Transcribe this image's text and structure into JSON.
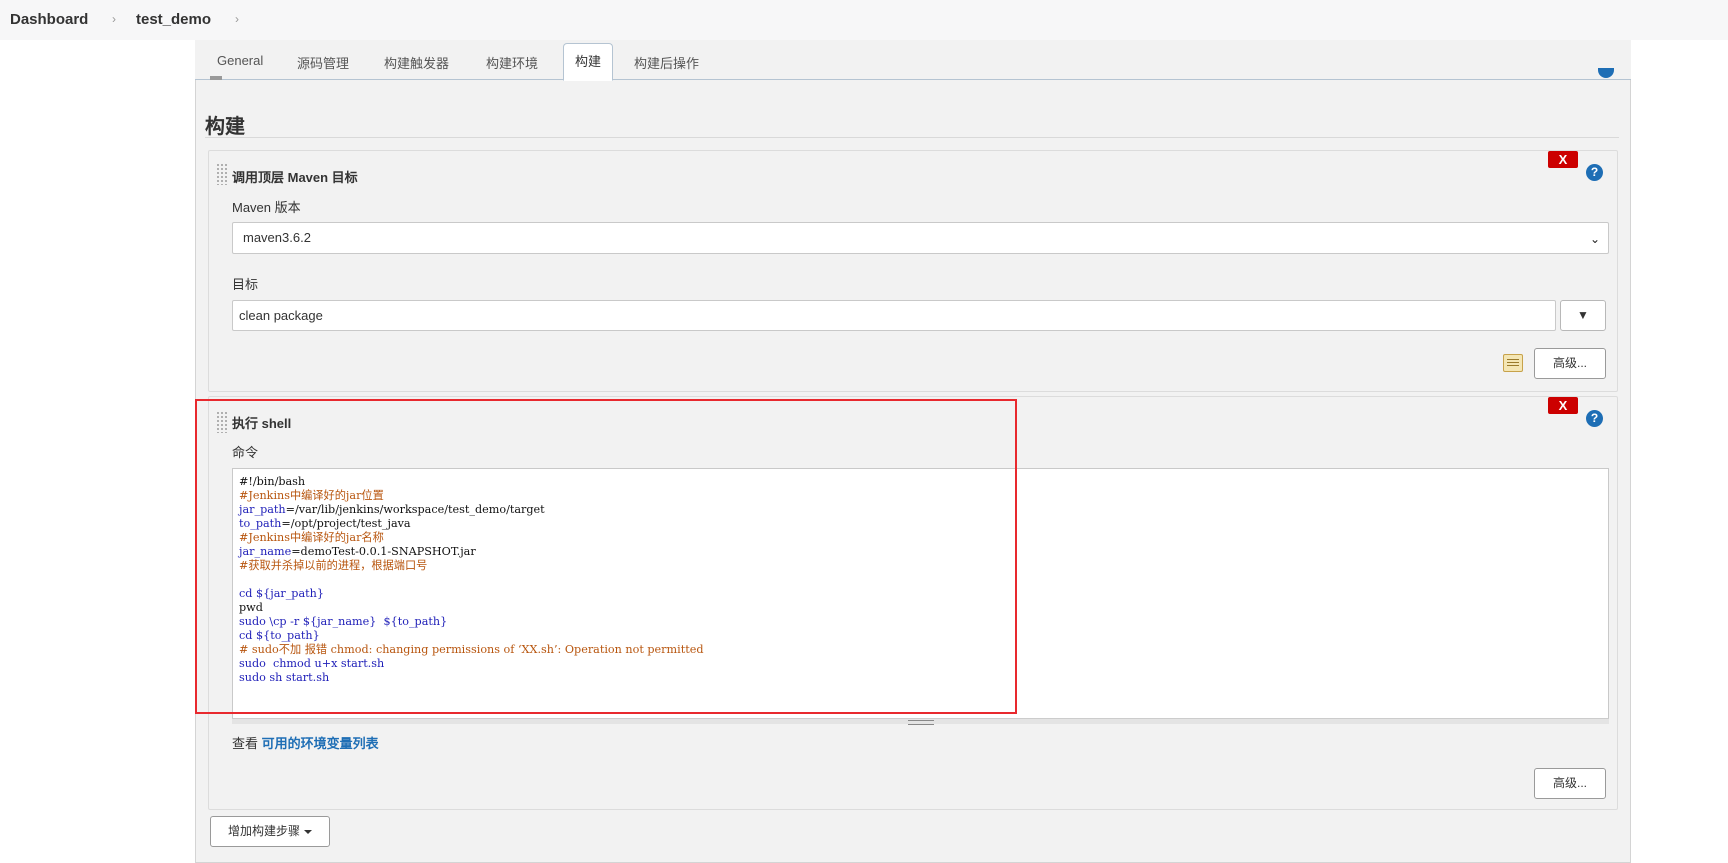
{
  "breadcrumb": {
    "items": [
      "Dashboard",
      "test_demo"
    ]
  },
  "tabs": [
    {
      "label": "General"
    },
    {
      "label": "源码管理"
    },
    {
      "label": "构建触发器"
    },
    {
      "label": "构建环境"
    },
    {
      "label": "构建"
    },
    {
      "label": "构建后操作"
    }
  ],
  "section": {
    "title": "构建"
  },
  "maven_step": {
    "title": "调用顶层 Maven 目标",
    "delete_label": "X",
    "help_label": "?",
    "version_label": "Maven 版本",
    "version_value": "maven3.6.2",
    "goals_label": "目标",
    "goals_value": "clean package",
    "advanced_label": "高级..."
  },
  "shell_step": {
    "title": "执行 shell",
    "delete_label": "X",
    "help_label": "?",
    "command_label": "命令",
    "code_lines": [
      {
        "text": "#!/bin/bash",
        "kind": "plain"
      },
      {
        "text": "#Jenkins中编译好的jar位置",
        "kind": "comment"
      },
      {
        "text": "jar_path=/var/lib/jenkins/workspace/test_demo/target",
        "kind": "assign"
      },
      {
        "text": "to_path=/opt/project/test_java",
        "kind": "assign"
      },
      {
        "text": "#Jenkins中编译好的jar名称",
        "kind": "comment"
      },
      {
        "text": "jar_name=demoTest-0.0.1-SNAPSHOT.jar",
        "kind": "assign"
      },
      {
        "text": "#获取并杀掉以前的进程，根据端口号",
        "kind": "comment"
      },
      {
        "text": "",
        "kind": "plain"
      },
      {
        "text": "cd ${jar_path}",
        "kind": "blue"
      },
      {
        "text": "pwd",
        "kind": "plain"
      },
      {
        "text": "sudo \\cp -r ${jar_name}  ${to_path}",
        "kind": "blue"
      },
      {
        "text": "cd ${to_path}",
        "kind": "blue"
      },
      {
        "text": "# sudo不加 报错 chmod: changing permissions of ‘XX.sh’: Operation not permitted",
        "kind": "comment"
      },
      {
        "text": "sudo  chmod u+x start.sh",
        "kind": "blue"
      },
      {
        "text": "sudo sh start.sh",
        "kind": "blue"
      }
    ],
    "env_prefix": "查看 ",
    "env_link": "可用的环境变量列表",
    "advanced_label": "高级..."
  },
  "add_step_label": "增加构建步骤",
  "colors": {
    "accent": "#1e6eb5",
    "delete": "#cc0000",
    "highlight": "#e8292e",
    "comment": "#b8560f",
    "keyword": "#1f1fb8"
  }
}
